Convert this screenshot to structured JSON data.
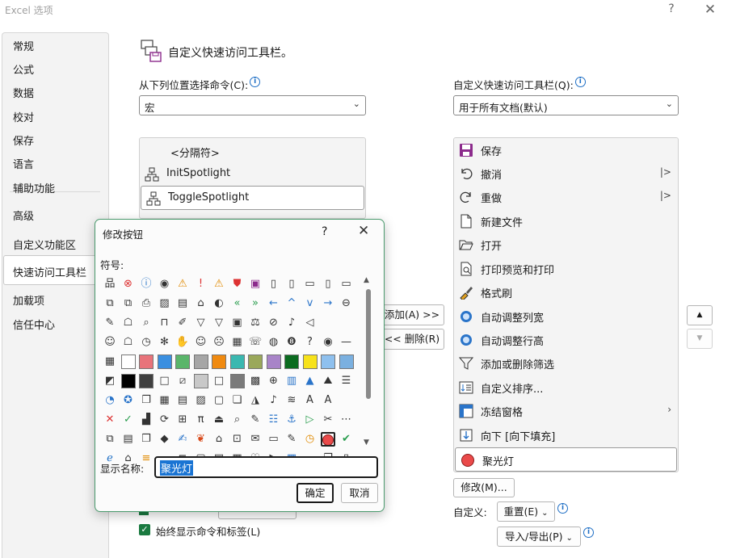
{
  "window": {
    "title": "Excel 选项",
    "help": "?",
    "close": "✕"
  },
  "nav": {
    "items": [
      {
        "label": "常规"
      },
      {
        "label": "公式"
      },
      {
        "label": "数据"
      },
      {
        "label": "校对"
      },
      {
        "label": "保存"
      },
      {
        "label": "语言"
      },
      {
        "label": "辅助功能"
      },
      {
        "label": "高级"
      },
      {
        "label": "自定义功能区"
      },
      {
        "label": "快速访问工具栏"
      },
      {
        "label": "加载项"
      },
      {
        "label": "信任中心"
      }
    ],
    "selected": "快速访问工具栏"
  },
  "main": {
    "header": "自定义快速访问工具栏。",
    "choose_label": "从下列位置选择命令(C):",
    "choose_value": "宏",
    "customize_label": "自定义快速访问工具栏(Q):",
    "customize_value": "用于所有文档(默认)",
    "left_list": [
      "<分隔符>",
      "InitSpotlight",
      "ToggleSpotlight"
    ],
    "left_selected": "ToggleSpotlight",
    "add_button": "添加(A) >>",
    "remove_button": "<< 删除(R)",
    "right_list": [
      {
        "label": "保存",
        "icon": "save-icon"
      },
      {
        "label": "撤消",
        "icon": "undo-icon",
        "split": true
      },
      {
        "label": "重做",
        "icon": "redo-icon",
        "split": true
      },
      {
        "label": "新建文件",
        "icon": "new-file-icon"
      },
      {
        "label": "打开",
        "icon": "open-folder-icon"
      },
      {
        "label": "打印预览和打印",
        "icon": "print-preview-icon"
      },
      {
        "label": "格式刷",
        "icon": "format-painter-icon"
      },
      {
        "label": "自动调整列宽",
        "icon": "autofit-column-icon"
      },
      {
        "label": "自动调整行高",
        "icon": "autofit-row-icon"
      },
      {
        "label": "添加或删除筛选",
        "icon": "filter-icon"
      },
      {
        "label": "自定义排序...",
        "icon": "sort-icon"
      },
      {
        "label": "冻结窗格",
        "icon": "freeze-panes-icon",
        "submenu": true
      },
      {
        "label": "向下 [向下填充]",
        "icon": "fill-down-icon"
      },
      {
        "label": "聚光灯",
        "icon": "red-circle-icon"
      }
    ],
    "right_selected": "聚光灯",
    "modify_button": "修改(M)...",
    "customize_row_label": "自定义:",
    "reset_button": "重置(E)",
    "import_export_button": "导入/导出(P)",
    "always_show_label": "始终显示命令和标签(L)",
    "always_show_checked": true,
    "up_arrow": "▲",
    "down_arrow": "▼"
  },
  "dialog": {
    "title": "修改按钮",
    "help": "?",
    "close": "✕",
    "symbol_label": "符号:",
    "display_name_label": "显示名称:",
    "display_name_value": "聚光灯",
    "ok_button": "确定",
    "cancel_button": "取消",
    "selected_symbol": "red-circle",
    "symbol_rows": [
      [
        "org-chart",
        "error-x",
        "info",
        "target",
        "warning",
        "exclamation",
        "warning-small",
        "shield",
        "floppy",
        "doc-plus",
        "doc-arrow",
        "folder",
        "page",
        "folder-outline"
      ],
      [
        "copy-tiles",
        "paste-tiles",
        "printer",
        "image",
        "doc-image",
        "house",
        "palette",
        "double-left",
        "double-right",
        "arrow-left",
        "caret-up",
        "caret-down",
        "arrow-right",
        "circle-left"
      ],
      [
        "pushpin",
        "person",
        "magnifier",
        "bookmark",
        "pencil",
        "filter",
        "filter-outline",
        "id-card",
        "scales",
        "no-sign",
        "microphone",
        "mute",
        "",
        ""
      ],
      [
        "user",
        "user-outline",
        "clock",
        "snowflake",
        "hand",
        "smile",
        "frown",
        "calculator",
        "phone",
        "piggy-bank",
        "8-ball",
        "question",
        "eye",
        "dash"
      ],
      [
        "apps",
        "sw-white",
        "sw-pink",
        "sw-blue",
        "sw-green",
        "sw-gray",
        "sw-orange",
        "sw-teal",
        "sw-olive",
        "sw-purple",
        "sw-darkgreen",
        "sw-yellow",
        "sw-lightblue",
        "sw-pattern"
      ],
      [
        "half",
        "sw-black",
        "grad-dark",
        "sq-outline",
        "slash-box",
        "grad-light",
        "sq-blank",
        "grad-mid",
        "checker",
        "arrow-circle",
        "bar-chart",
        "triangle-up",
        "mountain",
        "bars"
      ],
      [
        "pie",
        "star-badge",
        "doc-stack",
        "calendar",
        "slides",
        "picture",
        "frame",
        "shape-stack",
        "triangles",
        "bell",
        "stripes",
        "text-a",
        "text-a-gray",
        ""
      ],
      [
        "close-x",
        "checkmark",
        "chart-doc",
        "refresh",
        "align",
        "pi",
        "chart-up",
        "search",
        "brush",
        "list",
        "anchor",
        "play",
        "cut",
        "dots"
      ],
      [
        "copy2",
        "doc-lines",
        "window",
        "eraser",
        "draw",
        "butterfly",
        "unlock",
        "inbox",
        "mail",
        "idcard2",
        "edit",
        "clock-circle",
        "red-circle",
        "green-check"
      ],
      [
        "ie-logo",
        "home",
        "menu",
        "line",
        "crop",
        "frame2",
        "clipboard",
        "cube",
        "heart",
        "video",
        "grid",
        "rect",
        "layers",
        "doc-lock"
      ]
    ]
  }
}
